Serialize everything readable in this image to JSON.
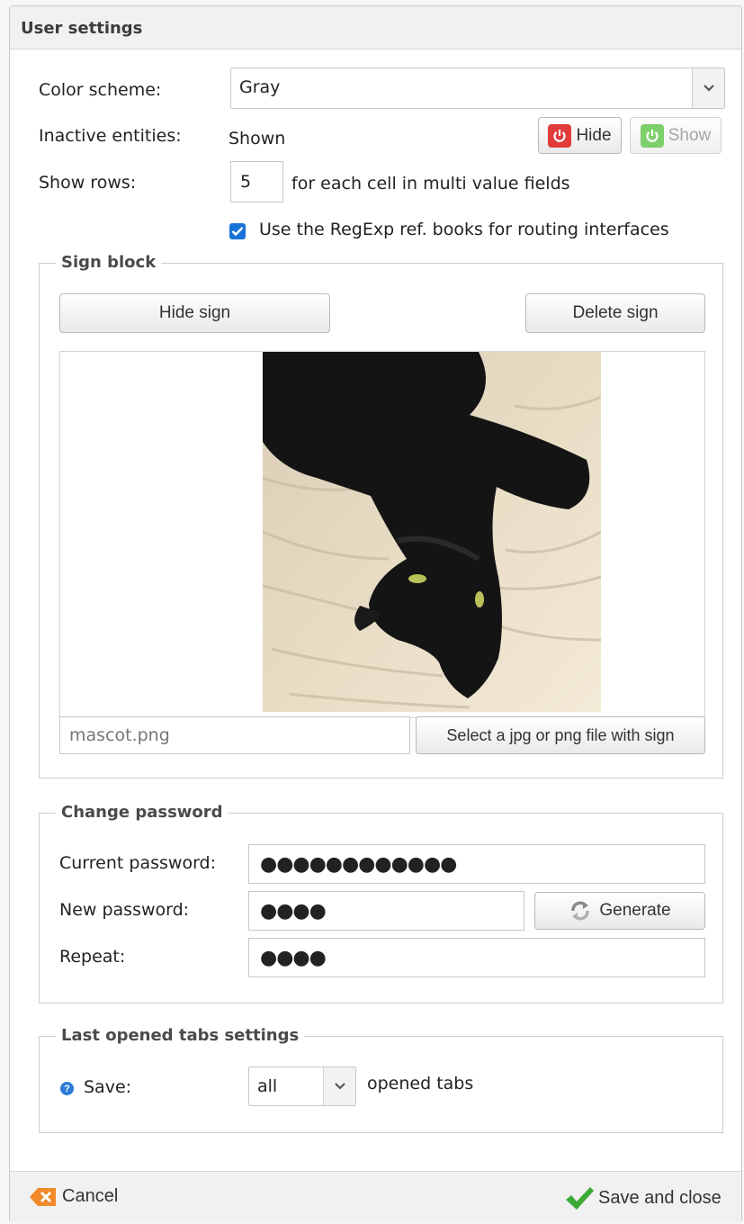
{
  "dialog": {
    "title": "User settings"
  },
  "settings": {
    "color_scheme_label": "Color scheme:",
    "color_scheme_value": "Gray",
    "inactive_entities_label": "Inactive entities:",
    "inactive_entities_value": "Shown",
    "hide_button": "Hide",
    "show_button": "Show",
    "show_rows_label": "Show rows:",
    "show_rows_value": "5",
    "show_rows_suffix": "for each cell in multi value fields",
    "regexp_checkbox_label": "Use the RegExp ref. books for routing interfaces",
    "regexp_checked": true
  },
  "sign_block": {
    "legend": "Sign block",
    "hide_sign_button": "Hide sign",
    "delete_sign_button": "Delete sign",
    "file_name": "mascot.png",
    "select_file_button": "Select a jpg or png file with sign"
  },
  "change_password": {
    "legend": "Change password",
    "current_label": "Current password:",
    "current_value": "●●●●●●●●●●●●",
    "new_label": "New password:",
    "new_value": "●●●●",
    "generate_button": "Generate",
    "repeat_label": "Repeat:",
    "repeat_value": "●●●●"
  },
  "last_tabs": {
    "legend": "Last opened tabs settings",
    "save_label": "Save:",
    "save_value": "all",
    "suffix": "opened tabs"
  },
  "footer": {
    "cancel_button": "Cancel",
    "save_close_button": "Save and close"
  },
  "colors": {
    "accent_blue": "#1a73d8",
    "hide_red": "#e23b3b",
    "show_green": "#7ccf6a",
    "cancel_orange": "#f08a2a",
    "save_green": "#3aa935"
  }
}
